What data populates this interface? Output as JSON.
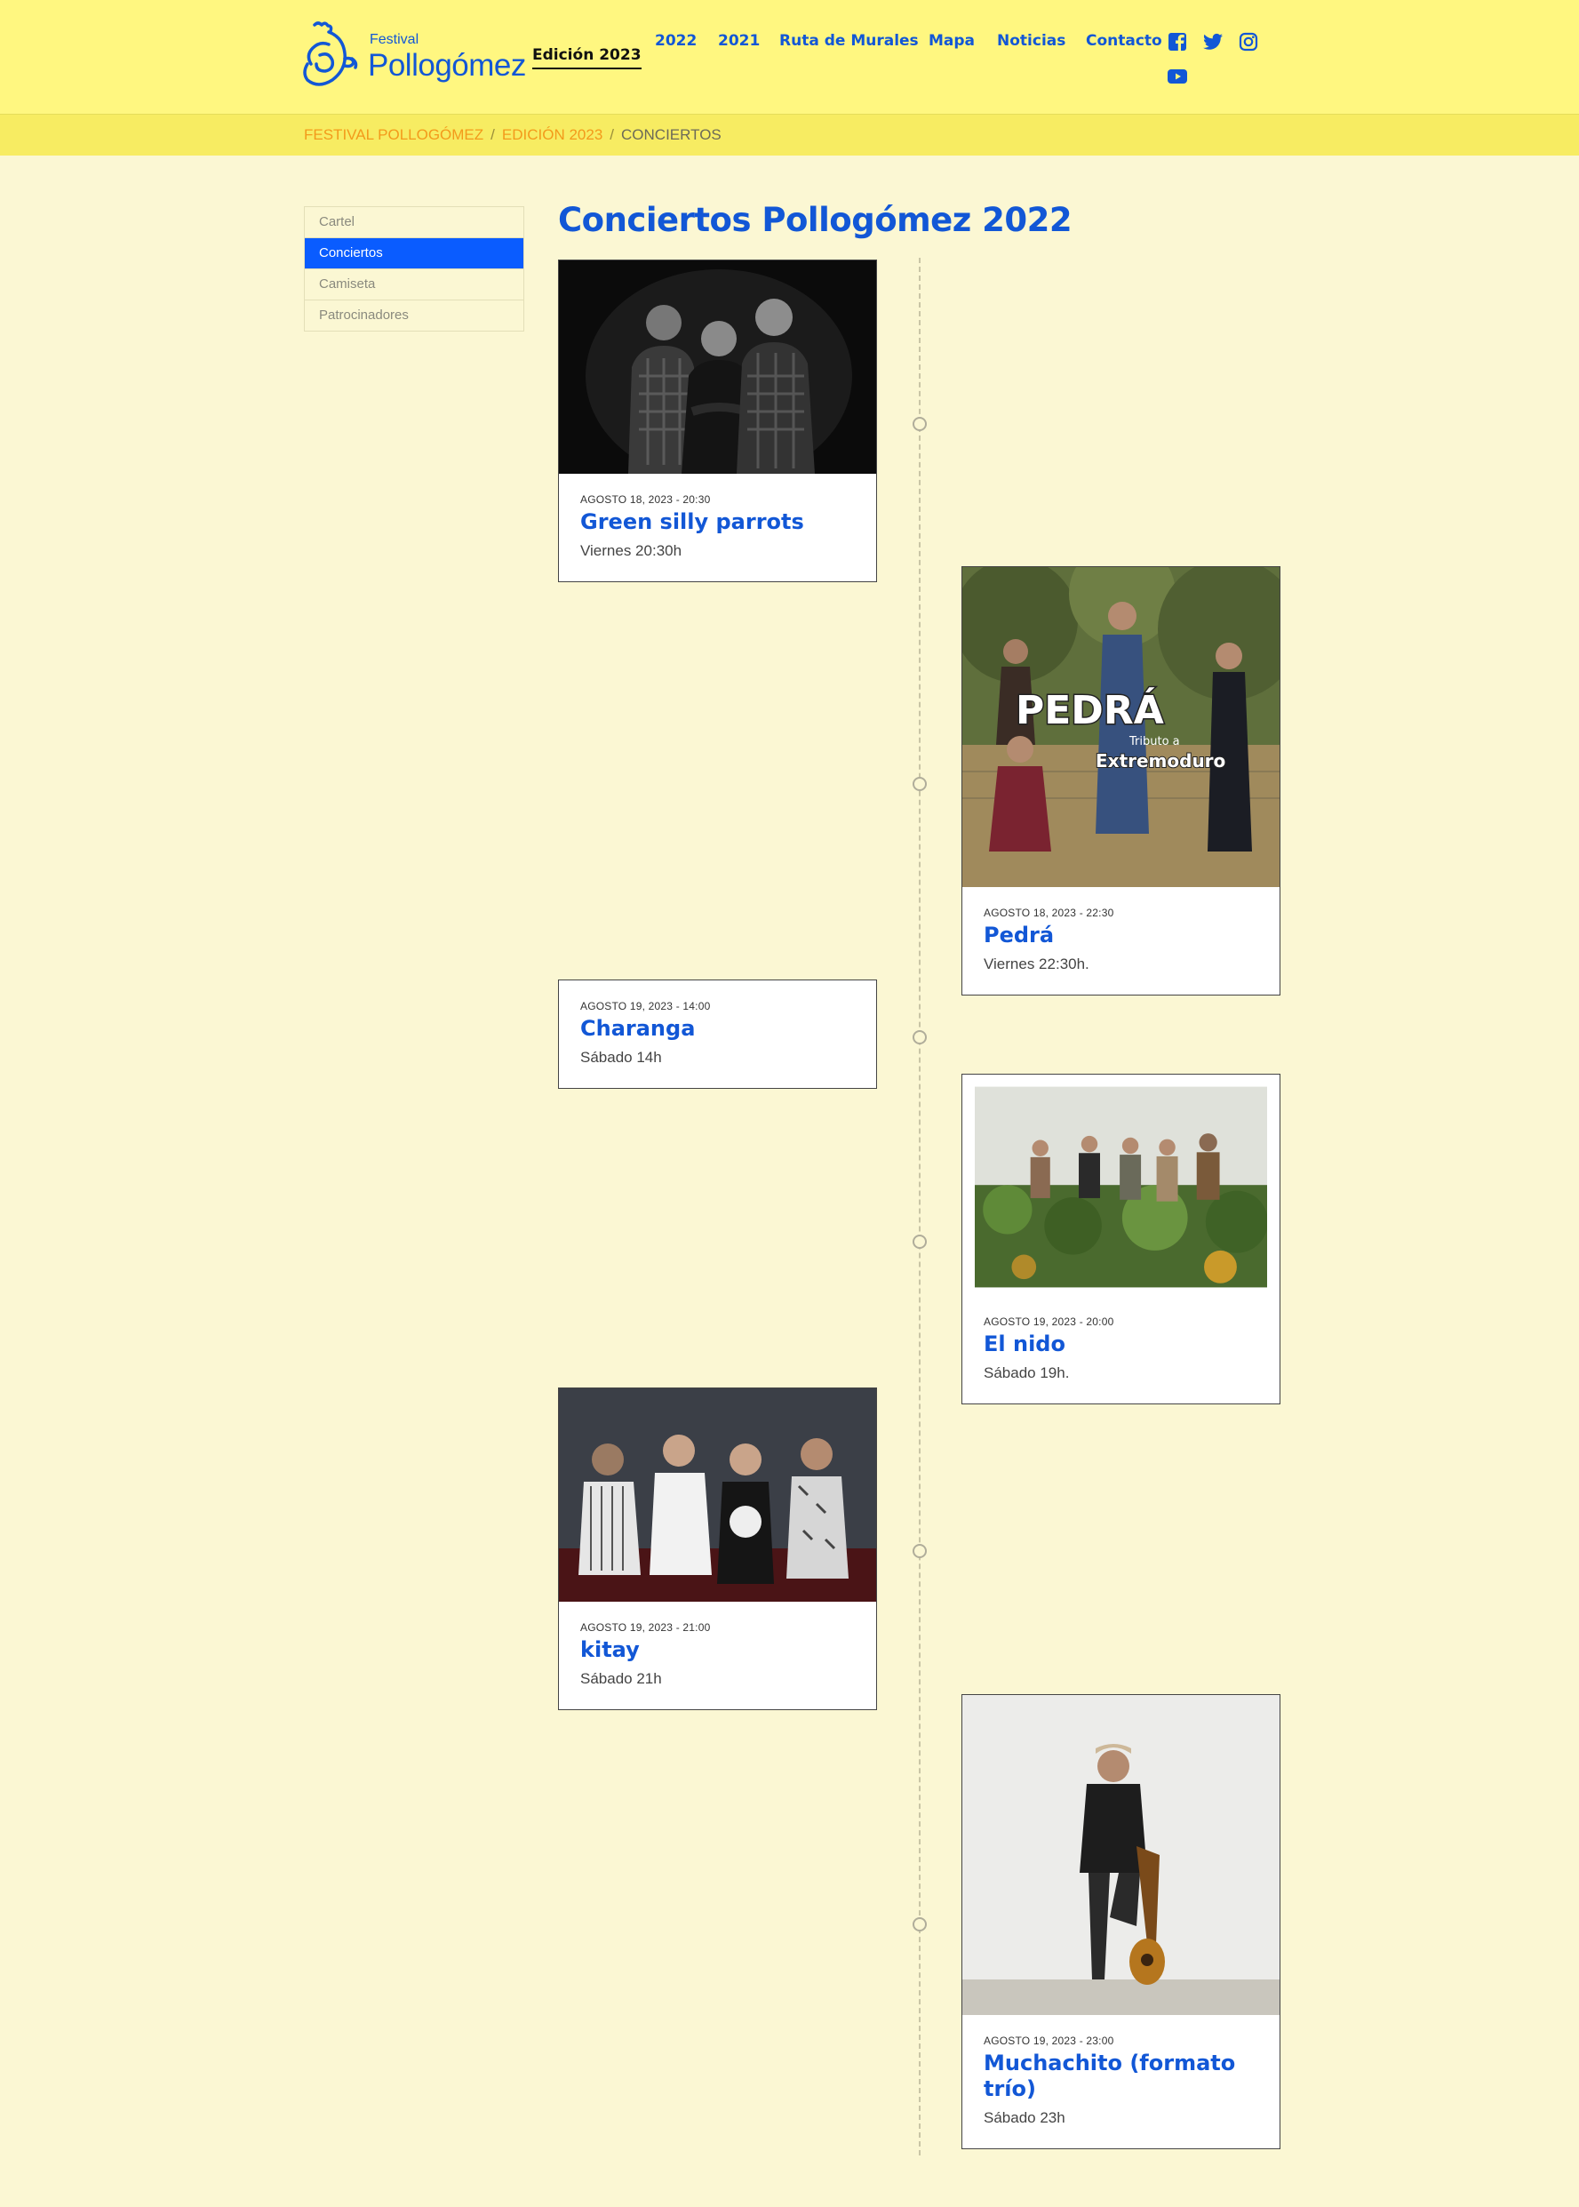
{
  "header": {
    "logo_small": "Festival",
    "logo_big": "Pollogómez",
    "nav": [
      {
        "label": "Edición 2023"
      },
      {
        "label": "2022"
      },
      {
        "label": "2021"
      },
      {
        "label": "Ruta de Murales"
      },
      {
        "label": "Mapa"
      },
      {
        "label": "Noticias"
      },
      {
        "label": "Contacto"
      }
    ],
    "social_icons": [
      "facebook-icon",
      "twitter-icon",
      "instagram-icon",
      "youtube-icon"
    ],
    "brand_color": "#1257d6"
  },
  "breadcrumb": {
    "items": [
      "FESTIVAL POLLOGÓMEZ",
      "EDICIÓN 2023",
      "CONCIERTOS"
    ],
    "separator": "/"
  },
  "sidebar": {
    "items": [
      {
        "label": "Cartel"
      },
      {
        "label": "Conciertos"
      },
      {
        "label": "Camiseta"
      },
      {
        "label": "Patrocinadores"
      }
    ],
    "active_index": 1
  },
  "main": {
    "title": "Conciertos Pollogómez 2022",
    "events": [
      {
        "date": "AGOSTO 18, 2023 - 20:30",
        "name": "Green silly parrots",
        "desc": "Viernes 20:30h"
      },
      {
        "date": "AGOSTO 18, 2023 - 22:30",
        "name": "Pedrá",
        "desc": "Viernes 22:30h.",
        "image_text": "PEDRÁ",
        "image_sub1": "Tributo a",
        "image_sub2": "Extremoduro"
      },
      {
        "date": "AGOSTO 19, 2023 - 14:00",
        "name": "Charanga",
        "desc": "Sábado 14h"
      },
      {
        "date": "AGOSTO 19, 2023 - 20:00",
        "name": "El nido",
        "desc": "Sábado 19h."
      },
      {
        "date": "AGOSTO 19, 2023 - 21:00",
        "name": "kitay",
        "desc": "Sábado 21h"
      },
      {
        "date": "AGOSTO 19, 2023 - 23:00",
        "name": "Muchachito (formato trío)",
        "desc": "Sábado 23h"
      }
    ]
  }
}
